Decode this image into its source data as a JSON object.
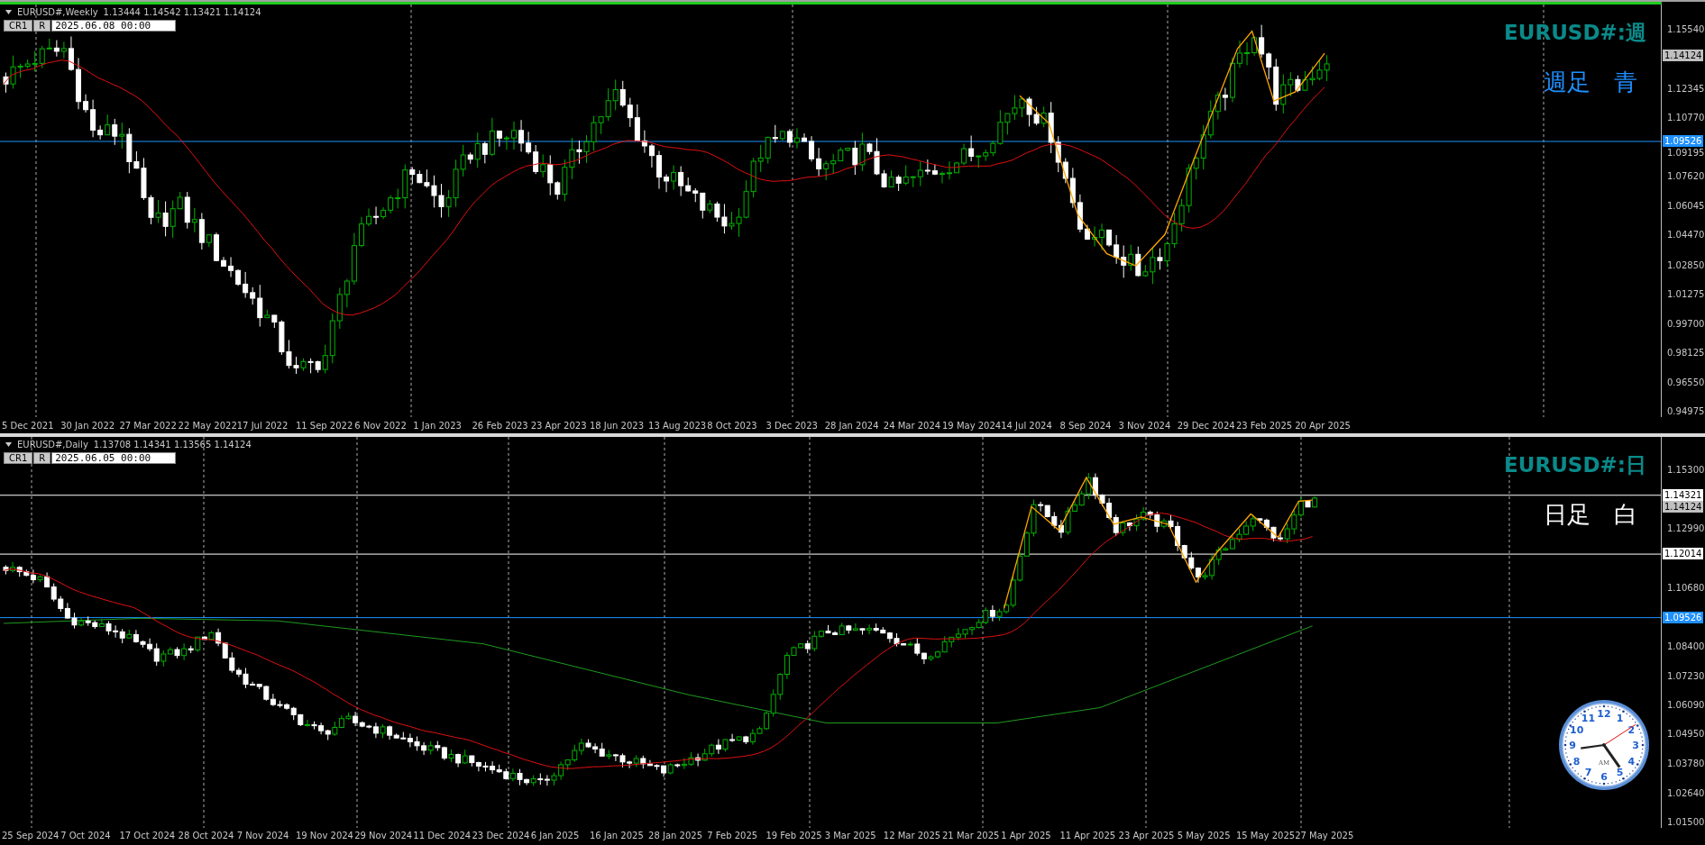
{
  "panes": [
    {
      "kind": "weekly",
      "header": {
        "symbol": "EURUSD#,Weekly",
        "ohlc": "1.13444 1.14542 1.13421 1.14124"
      },
      "buttons": [
        "CR1",
        "R"
      ],
      "date_field": "2025.06.08 00:00",
      "title": "EURUSD#:週",
      "subtitle": {
        "text": "週足　青",
        "color": "#1e90ff"
      },
      "price_ticks": [
        "1.15540",
        "1.12345",
        "1.10770",
        "1.09195",
        "1.07620",
        "1.06045",
        "1.04470",
        "1.02850",
        "1.01275",
        "0.99700",
        "0.98125",
        "0.96550",
        "0.94975"
      ],
      "price_tags": [
        {
          "value": "1.14124",
          "kind": "bid"
        },
        {
          "value": "1.09526",
          "kind": "level",
          "color": "#1e90ff"
        }
      ],
      "dates": [
        "5 Dec 2021",
        "30 Jan 2022",
        "27 Mar 2022",
        "22 May 2022",
        "17 Jul 2022",
        "11 Sep 2022",
        "6 Nov 2022",
        "1 Jan 2023",
        "26 Feb 2023",
        "23 Apr 2023",
        "18 Jun 2023",
        "13 Aug 2023",
        "8 Oct 2023",
        "3 Dec 2023",
        "28 Jan 2024",
        "24 Mar 2024",
        "19 May 2024",
        "14 Jul 2024",
        "8 Sep 2024",
        "3 Nov 2024",
        "29 Dec 2024",
        "23 Feb 2025",
        "20 Apr 2025"
      ]
    },
    {
      "kind": "daily",
      "header": {
        "symbol": "EURUSD#,Daily",
        "ohlc": "1.13708 1.14341 1.13565 1.14124"
      },
      "buttons": [
        "CR1",
        "R"
      ],
      "date_field": "2025.06.05 00:00",
      "title": "EURUSD#:日",
      "subtitle": {
        "text": "日足　白",
        "color": "#ffffff"
      },
      "price_ticks": [
        "1.15300",
        "1.12990",
        "1.10680",
        "1.08400",
        "1.07230",
        "1.06090",
        "1.04950",
        "1.03780",
        "1.02640",
        "1.01500"
      ],
      "price_tags": [
        {
          "value": "1.14321",
          "kind": "level",
          "color": "#ffffff"
        },
        {
          "value": "1.14124",
          "kind": "bid"
        },
        {
          "value": "1.12014",
          "kind": "level",
          "color": "#ffffff"
        },
        {
          "value": "1.09526",
          "kind": "level",
          "color": "#1e90ff"
        }
      ],
      "dates": [
        "25 Sep 2024",
        "7 Oct 2024",
        "17 Oct 2024",
        "28 Oct 2024",
        "7 Nov 2024",
        "19 Nov 2024",
        "29 Nov 2024",
        "11 Dec 2024",
        "23 Dec 2024",
        "6 Jan 2025",
        "16 Jan 2025",
        "28 Jan 2025",
        "7 Feb 2025",
        "19 Feb 2025",
        "3 Mar 2025",
        "12 Mar 2025",
        "21 Mar 2025",
        "1 Apr 2025",
        "11 Apr 2025",
        "23 Apr 2025",
        "5 May 2025",
        "15 May 2025",
        "27 May 2025"
      ],
      "clock": {
        "numerals": [
          "12",
          "11",
          "1",
          "10",
          "2",
          "9",
          "3",
          "8",
          "4",
          "7",
          "5",
          "6"
        ],
        "period": "AM"
      }
    }
  ]
}
